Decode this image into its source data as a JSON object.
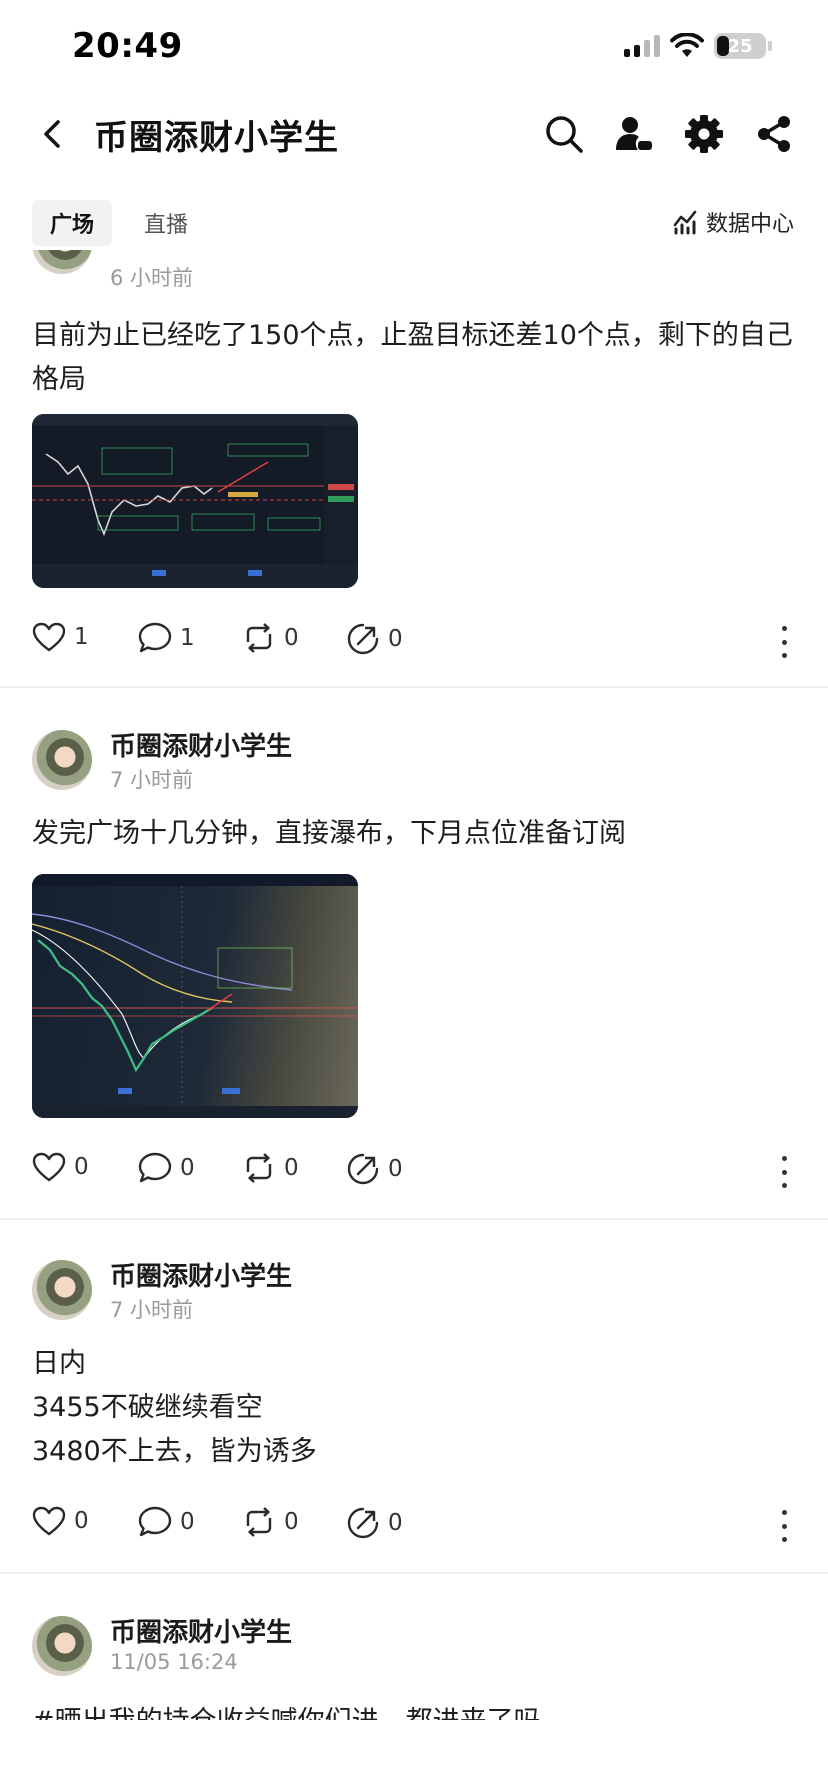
{
  "status_bar": {
    "time": "20:49",
    "battery": "25"
  },
  "header": {
    "title": "币圈添财小学生"
  },
  "tabs": [
    {
      "label": "广场"
    },
    {
      "label": "直播"
    }
  ],
  "data_center_label": "数据中心",
  "posts": [
    {
      "author": "",
      "time": "6 小时前",
      "text": "目前为止已经吃了150个点，止盈目标还差10个点，剩下的自己格局",
      "likes": "1",
      "comments": "1",
      "reposts": "0",
      "shares": "0"
    },
    {
      "author": "币圈添财小学生",
      "time": "7 小时前",
      "text": "发完广场十几分钟，直接瀑布，下月点位准备订阅",
      "likes": "0",
      "comments": "0",
      "reposts": "0",
      "shares": "0"
    },
    {
      "author": "币圈添财小学生",
      "time": "7 小时前",
      "text_lines": [
        "日内",
        "3455不破继续看空",
        "3480不上去，皆为诱多"
      ],
      "likes": "0",
      "comments": "0",
      "reposts": "0",
      "shares": "0"
    },
    {
      "author": "币圈添财小学生",
      "time": "11/05 16:24",
      "text": "#晒出我的持仓收益喊你们进，都进来了吗"
    }
  ]
}
